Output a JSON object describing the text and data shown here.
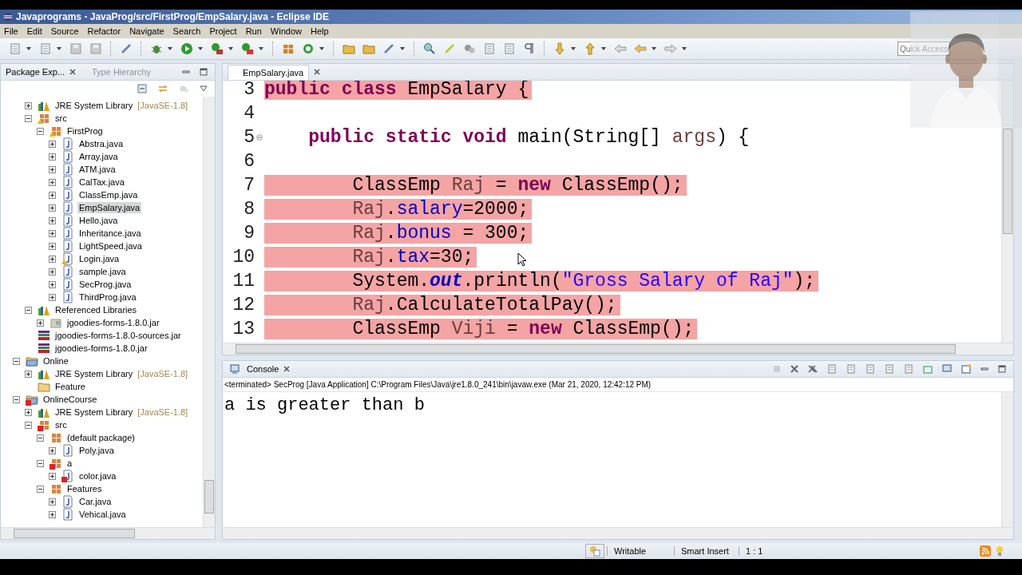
{
  "window": {
    "title": "Javaprograms - JavaProg/src/FirstProg/EmpSalary.java - Eclipse IDE"
  },
  "menu": [
    "File",
    "Edit",
    "Source",
    "Refactor",
    "Navigate",
    "Search",
    "Project",
    "Run",
    "Window",
    "Help"
  ],
  "quick_access": {
    "placeholder": "Quick Access"
  },
  "package_explorer": {
    "tabs": [
      {
        "label": "Package Exp...",
        "selected": true
      },
      {
        "label": "Type Hierarchy",
        "selected": false
      }
    ],
    "tree": [
      {
        "children": [
          {
            "label": "JRE System Library",
            "suffix": "[JavaSE-1.8]",
            "kind": "library",
            "expanded": false,
            "selected": false
          },
          {
            "label": "src",
            "kind": "source-folder",
            "warning": true,
            "expanded": true,
            "selected": false,
            "children": [
              {
                "label": "FirstProg",
                "kind": "package",
                "warning": true,
                "expanded": true,
                "selected": false,
                "children": [
                  {
                    "label": "Abstra.java",
                    "kind": "java",
                    "expanded": false,
                    "selected": false
                  },
                  {
                    "label": "Array.java",
                    "kind": "java",
                    "expanded": false,
                    "selected": false
                  },
                  {
                    "label": "ATM.java",
                    "kind": "java",
                    "expanded": false,
                    "selected": false
                  },
                  {
                    "label": "CalTax.java",
                    "kind": "java",
                    "expanded": false,
                    "selected": false
                  },
                  {
                    "label": "ClassEmp.java",
                    "kind": "java",
                    "expanded": false,
                    "selected": false
                  },
                  {
                    "label": "EmpSalary.java",
                    "kind": "java",
                    "expanded": false,
                    "selected": true
                  },
                  {
                    "label": "Hello.java",
                    "kind": "java",
                    "expanded": false,
                    "selected": false
                  },
                  {
                    "label": "Inheritance.java",
                    "kind": "java",
                    "expanded": false,
                    "selected": false
                  },
                  {
                    "label": "LightSpeed.java",
                    "kind": "java",
                    "expanded": false,
                    "selected": false
                  },
                  {
                    "label": "Login.java",
                    "kind": "java",
                    "warning": true,
                    "expanded": false,
                    "selected": false
                  },
                  {
                    "label": "sample.java",
                    "kind": "java",
                    "expanded": false,
                    "selected": false
                  },
                  {
                    "label": "SecProg.java",
                    "kind": "java",
                    "expanded": false,
                    "selected": false
                  },
                  {
                    "label": "ThirdProg.java",
                    "kind": "java",
                    "expanded": false,
                    "selected": false
                  }
                ]
              }
            ]
          },
          {
            "label": "Referenced Libraries",
            "kind": "library",
            "expanded": true,
            "selected": false,
            "children": [
              {
                "label": "jgoodies-forms-1.8.0.jar",
                "kind": "jar",
                "expanded": false,
                "selected": false
              }
            ]
          },
          {
            "label": "jgoodies-forms-1.8.0-sources.jar",
            "kind": "archive",
            "selected": false
          },
          {
            "label": "jgoodies-forms-1.8.0.jar",
            "kind": "archive",
            "selected": false
          }
        ]
      },
      {
        "label": "Online",
        "kind": "project",
        "expanded": true,
        "selected": false,
        "children": [
          {
            "label": "JRE System Library",
            "suffix": "[JavaSE-1.8]",
            "kind": "library",
            "expanded": false,
            "selected": false
          },
          {
            "label": "Feature",
            "kind": "folder",
            "selected": false
          }
        ]
      },
      {
        "label": "OnlineCourse",
        "kind": "project",
        "error": true,
        "expanded": true,
        "selected": false,
        "children": [
          {
            "label": "JRE System Library",
            "suffix": "[JavaSE-1.8]",
            "kind": "library",
            "expanded": false,
            "selected": false
          },
          {
            "label": "src",
            "kind": "source-folder",
            "error": true,
            "expanded": true,
            "selected": false,
            "children": [
              {
                "label": "(default package)",
                "kind": "package",
                "expanded": true,
                "selected": false,
                "children": [
                  {
                    "label": "Poly.java",
                    "kind": "java",
                    "expanded": false,
                    "selected": false
                  }
                ]
              },
              {
                "label": "a",
                "kind": "package",
                "error": true,
                "expanded": true,
                "selected": false,
                "children": [
                  {
                    "label": "color.java",
                    "kind": "java",
                    "error": true,
                    "expanded": false,
                    "selected": false
                  }
                ]
              },
              {
                "label": "Features",
                "kind": "package",
                "expanded": true,
                "selected": false,
                "children": [
                  {
                    "label": "Car.java",
                    "kind": "java",
                    "expanded": false,
                    "selected": false
                  },
                  {
                    "label": "Vehical.java",
                    "kind": "java",
                    "expanded": false,
                    "selected": false
                  }
                ]
              }
            ]
          }
        ]
      }
    ]
  },
  "editor": {
    "tabs": [
      {
        "label": "EmpSalary.java",
        "selected": true
      }
    ],
    "lines": [
      {
        "number": "3",
        "selected": true,
        "tokens": [
          {
            "kind": "keyword",
            "text": "public "
          },
          {
            "kind": "keyword",
            "text": "class "
          },
          {
            "kind": "plain",
            "text": "EmpSalary {"
          }
        ]
      },
      {
        "number": "4",
        "selected": false
      },
      {
        "number": "5",
        "selected": false,
        "collapsible": true,
        "tokens": [
          {
            "kind": "keyword",
            "text": "    public "
          },
          {
            "kind": "keyword",
            "text": "static "
          },
          {
            "kind": "keyword",
            "text": "void"
          },
          {
            "kind": "plain",
            "text": " main(String[] "
          },
          {
            "kind": "local",
            "text": "args"
          },
          {
            "kind": "plain",
            "text": ") {"
          }
        ]
      },
      {
        "number": "6",
        "selected": false
      },
      {
        "number": "7",
        "selected": true,
        "tokens": [
          {
            "kind": "plain",
            "text": "        ClassEmp "
          },
          {
            "kind": "local",
            "text": "Raj"
          },
          {
            "kind": "plain",
            "text": " = "
          },
          {
            "kind": "keyword",
            "text": "new"
          },
          {
            "kind": "plain",
            "text": " ClassEmp();"
          }
        ]
      },
      {
        "number": "8",
        "selected": true,
        "tokens": [
          {
            "kind": "local",
            "text": "        Raj"
          },
          {
            "kind": "plain",
            "text": "."
          },
          {
            "kind": "field",
            "text": "salary"
          },
          {
            "kind": "plain",
            "text": "=2000;"
          }
        ]
      },
      {
        "number": "9",
        "selected": true,
        "tokens": [
          {
            "kind": "local",
            "text": "        Raj"
          },
          {
            "kind": "plain",
            "text": "."
          },
          {
            "kind": "field",
            "text": "bonus"
          },
          {
            "kind": "plain",
            "text": " = 300;"
          }
        ]
      },
      {
        "number": "10",
        "selected": true,
        "tokens": [
          {
            "kind": "local",
            "text": "        Raj"
          },
          {
            "kind": "plain",
            "text": "."
          },
          {
            "kind": "field",
            "text": "tax"
          },
          {
            "kind": "plain",
            "text": "=30;"
          }
        ]
      },
      {
        "number": "11",
        "selected": true,
        "tokens": [
          {
            "kind": "plain",
            "text": "        System."
          },
          {
            "kind": "static",
            "text": "out"
          },
          {
            "kind": "plain",
            "text": ".println("
          },
          {
            "kind": "string",
            "text": "\"Gross Salary of Raj\""
          },
          {
            "kind": "plain",
            "text": ");"
          }
        ]
      },
      {
        "number": "12",
        "selected": true,
        "tokens": [
          {
            "kind": "local",
            "text": "        Raj"
          },
          {
            "kind": "plain",
            "text": ".CalculateTotalPay();"
          }
        ]
      },
      {
        "number": "13",
        "selected": true,
        "tokens": [
          {
            "kind": "plain",
            "text": "        ClassEmp "
          },
          {
            "kind": "local",
            "text": "Viji"
          },
          {
            "kind": "plain",
            "text": " = "
          },
          {
            "kind": "keyword",
            "text": "new"
          },
          {
            "kind": "plain",
            "text": " ClassEmp();"
          }
        ]
      }
    ]
  },
  "console": {
    "tabs": [
      {
        "label": "Console",
        "selected": true
      }
    ],
    "description": "<terminated> SecProg [Java Application] C:\\Program Files\\Java\\jre1.8.0_241\\bin\\javaw.exe (Mar 21, 2020, 12:42:12 PM)",
    "output": [
      "a is greater than b"
    ]
  },
  "status_bar": {
    "mode": "Writable",
    "insert_mode": "Smart Insert",
    "position": "1 : 1"
  }
}
